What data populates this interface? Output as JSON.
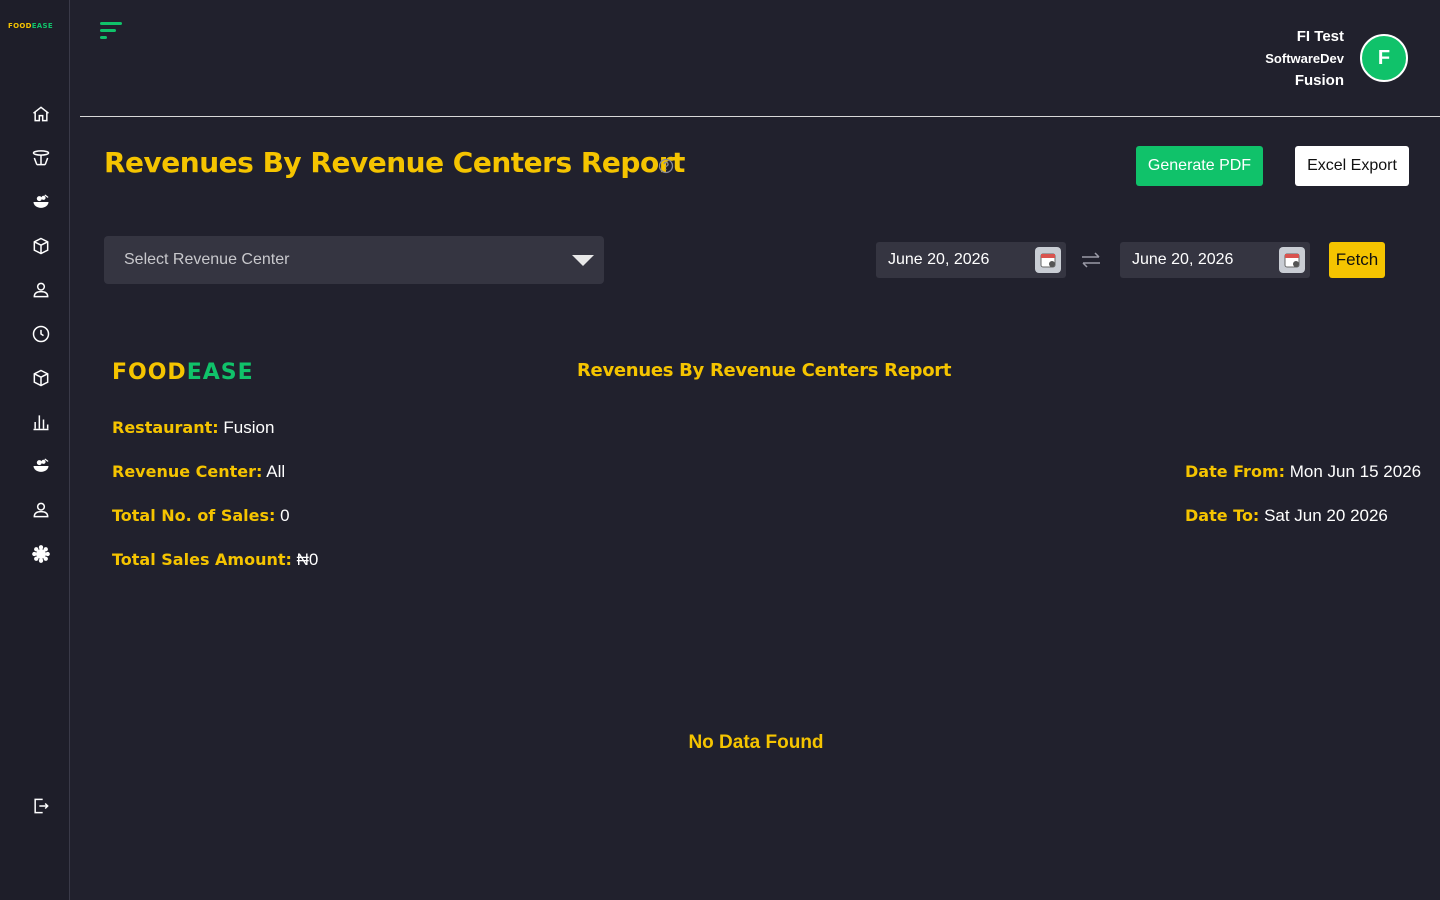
{
  "app": {
    "logo_food": "FOOD",
    "logo_ease": "EASE"
  },
  "sidebar": {
    "items": [
      {
        "icon": "home-icon"
      },
      {
        "icon": "table-icon"
      },
      {
        "icon": "menu-food-icon"
      },
      {
        "icon": "box-icon"
      },
      {
        "icon": "user-icon"
      },
      {
        "icon": "clock-icon"
      },
      {
        "icon": "package-icon"
      },
      {
        "icon": "bar-chart-icon"
      },
      {
        "icon": "food-icon"
      },
      {
        "icon": "staff-icon"
      },
      {
        "icon": "settings-icon"
      }
    ],
    "logout_icon": "logout-icon"
  },
  "header": {
    "user_name": "FI Test",
    "user_role": "SoftwareDev",
    "restaurant": "Fusion",
    "avatar_initial": "F"
  },
  "page": {
    "title": "Revenues By Revenue Centers Report",
    "generate_pdf": "Generate PDF",
    "excel_export": "Excel Export"
  },
  "filters": {
    "revenue_center_placeholder": "Select Revenue Center",
    "date_from": "June 20, 2026",
    "date_to": "June 20, 2026",
    "fetch": "Fetch"
  },
  "report": {
    "brand_food": "FOOD",
    "brand_ease": "EASE",
    "title": "Revenues By Revenue Centers Report",
    "restaurant_label": "Restaurant:",
    "restaurant_value": "Fusion",
    "revenue_center_label": "Revenue Center:",
    "revenue_center_value": "All",
    "total_sales_label": "Total No. of Sales:",
    "total_sales_value": "0",
    "total_amount_label": "Total Sales Amount:",
    "total_amount_value": "₦0",
    "date_from_label": "Date From:",
    "date_from_value": "Mon Jun 15 2026",
    "date_to_label": "Date To:",
    "date_to_value": "Sat Jun 20 2026",
    "empty_message": "No Data Found"
  },
  "colors": {
    "background": "#21212d",
    "accent_yellow": "#f5c400",
    "accent_green": "#10c26a"
  }
}
